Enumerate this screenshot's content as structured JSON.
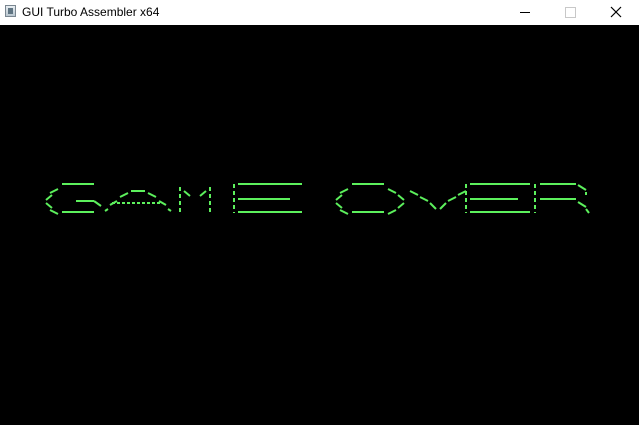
{
  "window": {
    "title": "GUI Turbo Assembler x64",
    "controls": {
      "minimize": "minimize-icon",
      "maximize": "maximize-icon",
      "close": "close-icon"
    }
  },
  "screen": {
    "message": "GAME OVER",
    "text_color": "#5cf05c",
    "background": "#000000"
  }
}
